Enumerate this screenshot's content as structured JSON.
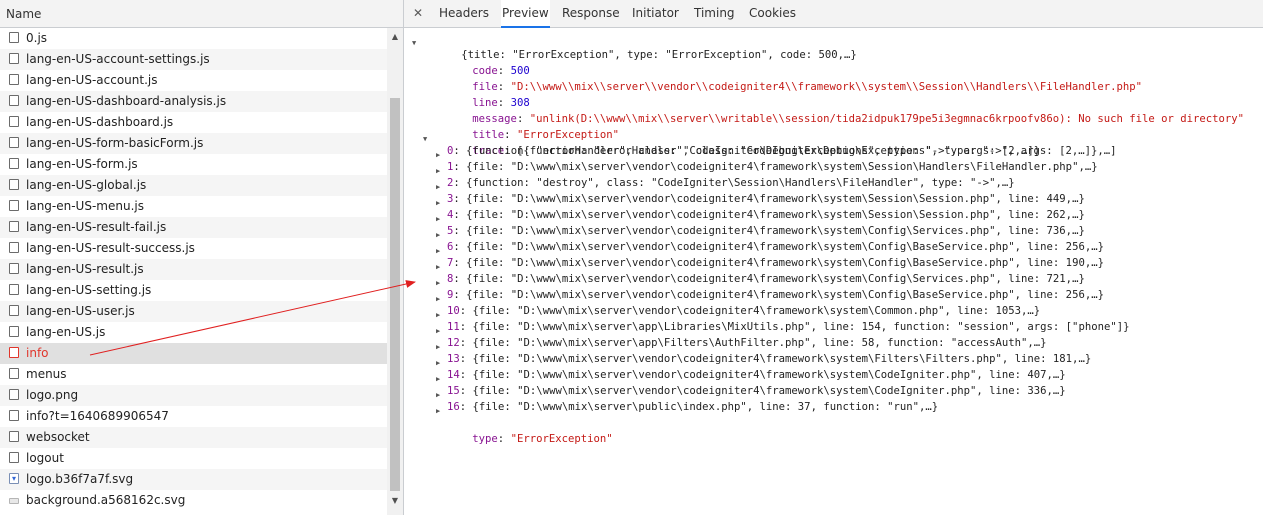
{
  "left_panel": {
    "header": "Name",
    "rows": [
      {
        "name": "0.js"
      },
      {
        "name": "lang-en-US-account-settings.js"
      },
      {
        "name": "lang-en-US-account.js"
      },
      {
        "name": "lang-en-US-dashboard-analysis.js"
      },
      {
        "name": "lang-en-US-dashboard.js"
      },
      {
        "name": "lang-en-US-form-basicForm.js"
      },
      {
        "name": "lang-en-US-form.js"
      },
      {
        "name": "lang-en-US-global.js"
      },
      {
        "name": "lang-en-US-menu.js"
      },
      {
        "name": "lang-en-US-result-fail.js"
      },
      {
        "name": "lang-en-US-result-success.js"
      },
      {
        "name": "lang-en-US-result.js"
      },
      {
        "name": "lang-en-US-setting.js"
      },
      {
        "name": "lang-en-US-user.js"
      },
      {
        "name": "lang-en-US.js"
      },
      {
        "name": "info",
        "status": "error",
        "selected": true
      },
      {
        "name": "menus"
      },
      {
        "name": "logo.png"
      },
      {
        "name": "info?t=1640689906547"
      },
      {
        "name": "websocket"
      },
      {
        "name": "logout"
      },
      {
        "name": "logo.b36f7a7f.svg",
        "icon": "svg-file-icon"
      },
      {
        "name": "background.a568162c.svg",
        "icon": "image-file-icon"
      }
    ],
    "scrollbar": {
      "up_icon": "▲",
      "down_icon": "▼"
    }
  },
  "tabs": {
    "close_icon": "✕",
    "items": [
      "Headers",
      "Preview",
      "Response",
      "Initiator",
      "Timing",
      "Cookies"
    ],
    "active": "Preview"
  },
  "preview": {
    "root_summary": "{title: \"ErrorException\", type: \"ErrorException\", code: 500,…}",
    "fields": {
      "code": {
        "key": "code",
        "value": "500"
      },
      "file": {
        "key": "file",
        "value": "\"D:\\\\www\\\\mix\\\\server\\\\vendor\\\\codeigniter4\\\\framework\\\\system\\\\Session\\\\Handlers\\\\FileHandler.php\""
      },
      "line": {
        "key": "line",
        "value": "308"
      },
      "message": {
        "key": "message",
        "value": "\"unlink(D:\\\\www\\\\mix\\\\server\\\\writable\\\\session/tida2idpuk179pe5i3egmnac6krpoofv86o): No such file or directory\""
      },
      "title": {
        "key": "title",
        "value": "\"ErrorException\""
      },
      "trace": {
        "key": "trace",
        "summary": "[{function: \"errorHandler\", class: \"CodeIgniter\\Debug\\Exceptions\", type: \"->\", args: [2,…]},…]"
      },
      "type": {
        "key": "type",
        "value": "\"ErrorException\""
      }
    },
    "trace_items": [
      {
        "index": "0",
        "summary": "{function: \"errorHandler\", class: \"CodeIgniter\\Debug\\Exceptions\", type: \"->\", args: [2,…]}"
      },
      {
        "index": "1",
        "summary": "{file: \"D:\\www\\mix\\server\\vendor\\codeigniter4\\framework\\system\\Session\\Handlers\\FileHandler.php\",…}"
      },
      {
        "index": "2",
        "summary": "{function: \"destroy\", class: \"CodeIgniter\\Session\\Handlers\\FileHandler\", type: \"->\",…}"
      },
      {
        "index": "3",
        "summary": "{file: \"D:\\www\\mix\\server\\vendor\\codeigniter4\\framework\\system\\Session\\Session.php\", line: 449,…}"
      },
      {
        "index": "4",
        "summary": "{file: \"D:\\www\\mix\\server\\vendor\\codeigniter4\\framework\\system\\Session\\Session.php\", line: 262,…}"
      },
      {
        "index": "5",
        "summary": "{file: \"D:\\www\\mix\\server\\vendor\\codeigniter4\\framework\\system\\Config\\Services.php\", line: 736,…}"
      },
      {
        "index": "6",
        "summary": "{file: \"D:\\www\\mix\\server\\vendor\\codeigniter4\\framework\\system\\Config\\BaseService.php\", line: 256,…}"
      },
      {
        "index": "7",
        "summary": "{file: \"D:\\www\\mix\\server\\vendor\\codeigniter4\\framework\\system\\Config\\BaseService.php\", line: 190,…}"
      },
      {
        "index": "8",
        "summary": "{file: \"D:\\www\\mix\\server\\vendor\\codeigniter4\\framework\\system\\Config\\Services.php\", line: 721,…}"
      },
      {
        "index": "9",
        "summary": "{file: \"D:\\www\\mix\\server\\vendor\\codeigniter4\\framework\\system\\Config\\BaseService.php\", line: 256,…}"
      },
      {
        "index": "10",
        "summary": "{file: \"D:\\www\\mix\\server\\vendor\\codeigniter4\\framework\\system\\Common.php\", line: 1053,…}"
      },
      {
        "index": "11",
        "summary": "{file: \"D:\\www\\mix\\server\\app\\Libraries\\MixUtils.php\", line: 154, function: \"session\", args: [\"phone\"]}"
      },
      {
        "index": "12",
        "summary": "{file: \"D:\\www\\mix\\server\\app\\Filters\\AuthFilter.php\", line: 58, function: \"accessAuth\",…}"
      },
      {
        "index": "13",
        "summary": "{file: \"D:\\www\\mix\\server\\vendor\\codeigniter4\\framework\\system\\Filters\\Filters.php\", line: 181,…}"
      },
      {
        "index": "14",
        "summary": "{file: \"D:\\www\\mix\\server\\vendor\\codeigniter4\\framework\\system\\CodeIgniter.php\", line: 407,…}"
      },
      {
        "index": "15",
        "summary": "{file: \"D:\\www\\mix\\server\\vendor\\codeigniter4\\framework\\system\\CodeIgniter.php\", line: 336,…}"
      },
      {
        "index": "16",
        "summary": "{file: \"D:\\www\\mix\\server\\public\\index.php\", line: 37, function: \"run\",…}"
      }
    ]
  },
  "icons": {
    "expanded": "▼",
    "collapsed": "▶"
  },
  "colors": {
    "accent": "#1a73e8",
    "error": "#e0352b",
    "key": "#881391",
    "string": "#c41a16",
    "number": "#1c00cf",
    "annotation_arrow": "#e02020"
  }
}
